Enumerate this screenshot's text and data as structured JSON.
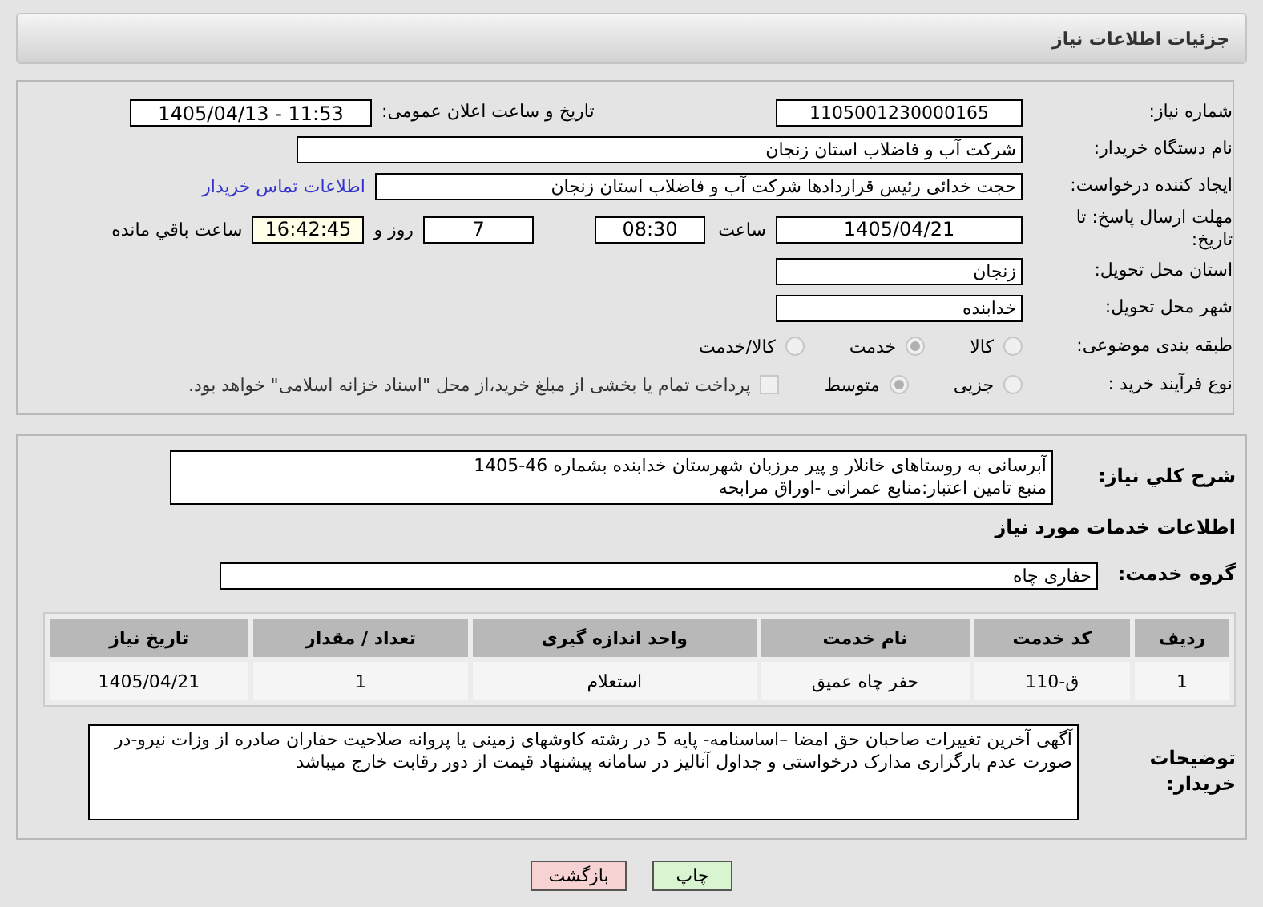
{
  "header": {
    "title": "جزئیات اطلاعات نیاز"
  },
  "need_number": {
    "label": "شماره نیاز:",
    "value": "1105001230000165"
  },
  "announce": {
    "label": "تاریخ و ساعت اعلان عمومی:",
    "value": "1405/04/13 - 11:53"
  },
  "buyer": {
    "label": "نام دستگاه خریدار:",
    "value": "شرکت آب و فاضلاب استان زنجان"
  },
  "creator": {
    "label": "ایجاد کننده درخواست:",
    "value": "حجت  خدائی رئیس قراردادها شرکت آب و فاضلاب استان زنجان",
    "link": "اطلاعات تماس خریدار"
  },
  "deadline": {
    "label": "مهلت ارسال پاسخ: تا تاریخ:",
    "date": "1405/04/21",
    "time_label": "ساعت",
    "time": "08:30",
    "days": "7",
    "days_label": "روز و",
    "remaining": "16:42:45",
    "remaining_label": "ساعت باقي مانده"
  },
  "province": {
    "label": "استان محل تحویل:",
    "value": "زنجان"
  },
  "city": {
    "label": "شهر محل تحویل:",
    "value": "خدابنده"
  },
  "category": {
    "label": "طبقه بندی موضوعی:",
    "options": [
      {
        "label": "کالا",
        "selected": false
      },
      {
        "label": "خدمت",
        "selected": true
      },
      {
        "label": "کالا/خدمت",
        "selected": false
      }
    ]
  },
  "process": {
    "label": "نوع فرآیند خرید :",
    "options": [
      {
        "label": "جزیی",
        "selected": false
      },
      {
        "label": "متوسط",
        "selected": true
      }
    ],
    "treasury": {
      "label": "پرداخت تمام یا بخشی از مبلغ خرید،از محل \"اسناد خزانه اسلامی\" خواهد بود.",
      "checked": false
    }
  },
  "description": {
    "label": "شرح کلي نياز:",
    "lines": [
      "آبرسانی به روستاهای خانلار و پیر مرزبان شهرستان خدابنده بشماره 46-1405",
      "منبع تامین اعتبار:منابع عمرانی -اوراق مرابحه"
    ]
  },
  "services_title": "اطلاعات خدمات مورد نیاز",
  "service_group": {
    "label": "گروه خدمت:",
    "value": "حفاری چاه"
  },
  "table": {
    "columns": [
      "ردیف",
      "کد خدمت",
      "نام خدمت",
      "واحد اندازه گیری",
      "تعداد / مقدار",
      "تاریخ نیاز"
    ],
    "rows": [
      [
        "1",
        "ق-110",
        "حفر چاه عمیق",
        "استعلام",
        "1",
        "1405/04/21"
      ]
    ]
  },
  "buyer_notes": {
    "label": "توضیحات خریدار:",
    "text": "آگهی آخرین تغییرات صاحبان حق امضا –اساسنامه- پایه 5 در رشته کاوشهای زمینی یا پروانه صلاحیت حفاران صادره از وزات نیرو-در صورت عدم بارگزاری مدارک درخواستی و جداول آنالیز در سامانه پیشنهاد قیمت از دور رقابت خارج میباشد"
  },
  "buttons": [
    {
      "label": "چاپ",
      "kind": "print"
    },
    {
      "label": "بازگشت",
      "kind": "back"
    }
  ]
}
